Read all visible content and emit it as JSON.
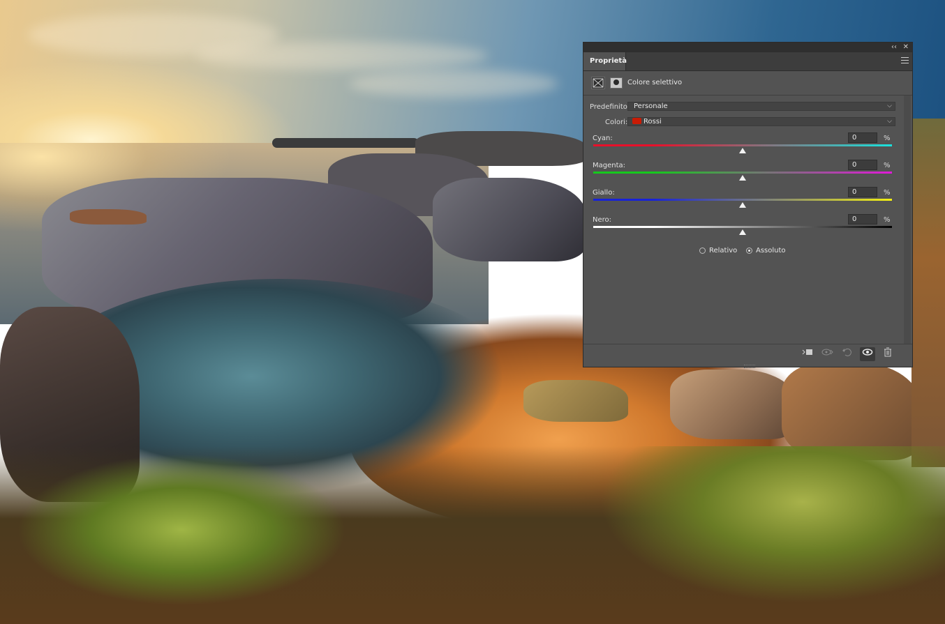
{
  "panel": {
    "tab_label": "Proprietà",
    "collapse_label": "‹‹",
    "close_label": "✕",
    "adjustment_title": "Colore selettivo",
    "preset_label": "Predefinito:",
    "preset_value": "Personale",
    "colors_label": "Colori:",
    "colors_value": "Rossi",
    "colors_swatch": "#c91b05",
    "sliders": [
      {
        "label": "Cyan:",
        "value": "0",
        "unit": "%",
        "gradient": [
          "#e8102a",
          "#19e2dd"
        ]
      },
      {
        "label": "Magenta:",
        "value": "0",
        "unit": "%",
        "gradient": [
          "#16c81d",
          "#e01ad8"
        ]
      },
      {
        "label": "Giallo:",
        "value": "0",
        "unit": "%",
        "gradient": [
          "#1722d8",
          "#f2ef12"
        ]
      },
      {
        "label": "Nero:",
        "value": "0",
        "unit": "%",
        "gradient": [
          "#ffffff",
          "#000000"
        ]
      }
    ],
    "method": {
      "relative_label": "Relativo",
      "absolute_label": "Assoluto",
      "selected": "Assoluto"
    },
    "footer_icons": [
      "clip-to-layer-icon",
      "view-previous-state-icon",
      "reset-icon",
      "visibility-eye-icon",
      "trash-icon"
    ]
  }
}
